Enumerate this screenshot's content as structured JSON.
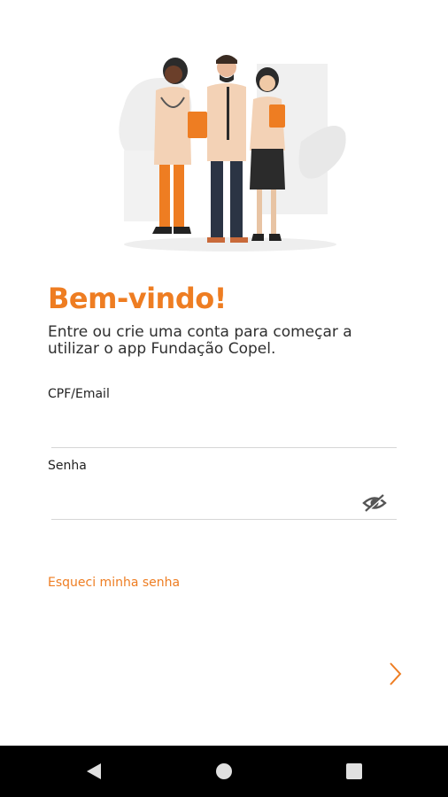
{
  "welcome": {
    "title": "Bem-vindo!",
    "subtitle": "Entre ou crie uma conta para começar a utilizar o app Fundação Copel."
  },
  "login_form": {
    "cpf_label": "CPF/Email",
    "cpf_value": "",
    "password_label": "Senha",
    "password_value": "",
    "password_visibility_icon": "eye-off-icon",
    "forgot_password": "Esqueci minha senha",
    "next_icon": "chevron-right-icon"
  },
  "illustration": {
    "icon": "doctors-illustration"
  },
  "system_nav": {
    "back_icon": "back-triangle-icon",
    "home_icon": "home-circle-icon",
    "recents_icon": "recents-square-icon"
  },
  "colors": {
    "accent": "#EE7D22",
    "text": "#2f2f2f",
    "nav_bar": "#000000",
    "divider": "#d6d6d6"
  }
}
